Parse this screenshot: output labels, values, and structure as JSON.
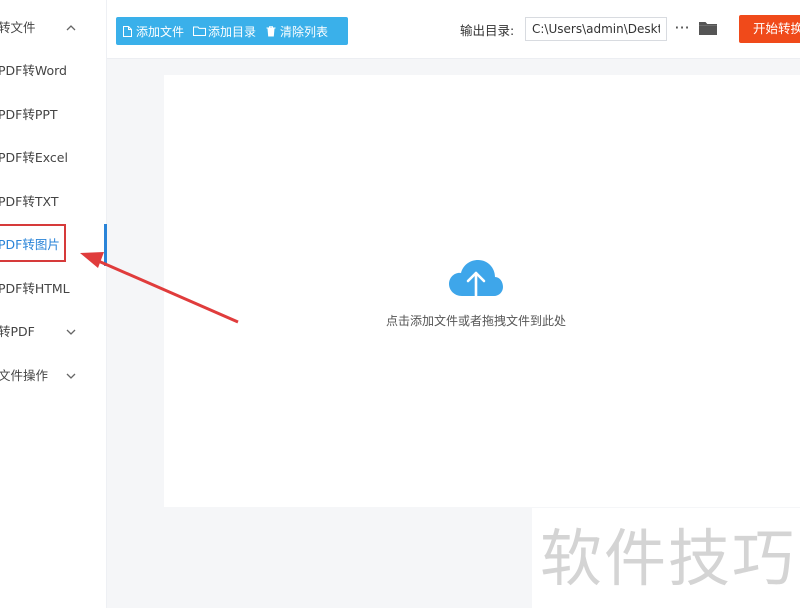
{
  "sidebar": {
    "items": [
      {
        "label": "转文件",
        "chevron": "^"
      },
      {
        "label": "PDF转Word"
      },
      {
        "label": "PDF转PPT"
      },
      {
        "label": "PDF转Excel"
      },
      {
        "label": "PDF转TXT"
      },
      {
        "label": "PDF转图片",
        "active": true
      },
      {
        "label": "PDF转HTML"
      },
      {
        "label": "转PDF",
        "chevron": "v"
      },
      {
        "label": "文件操作",
        "chevron": "v"
      }
    ]
  },
  "toolbar": {
    "add_file": "添加文件",
    "add_folder": "添加目录",
    "clear_list": "清除列表",
    "output_label": "输出目录:",
    "output_path": "C:\\Users\\admin\\Deskto",
    "more": "···",
    "start": "开始转换"
  },
  "dropzone": {
    "text": "点击添加文件或者拖拽文件到此处"
  },
  "watermark": {
    "text": "软件技巧"
  },
  "colors": {
    "accent": "#3ab0ea",
    "start_button": "#f04a1a",
    "active_nav": "#2a84d8",
    "annotation": "#d63a3a"
  }
}
